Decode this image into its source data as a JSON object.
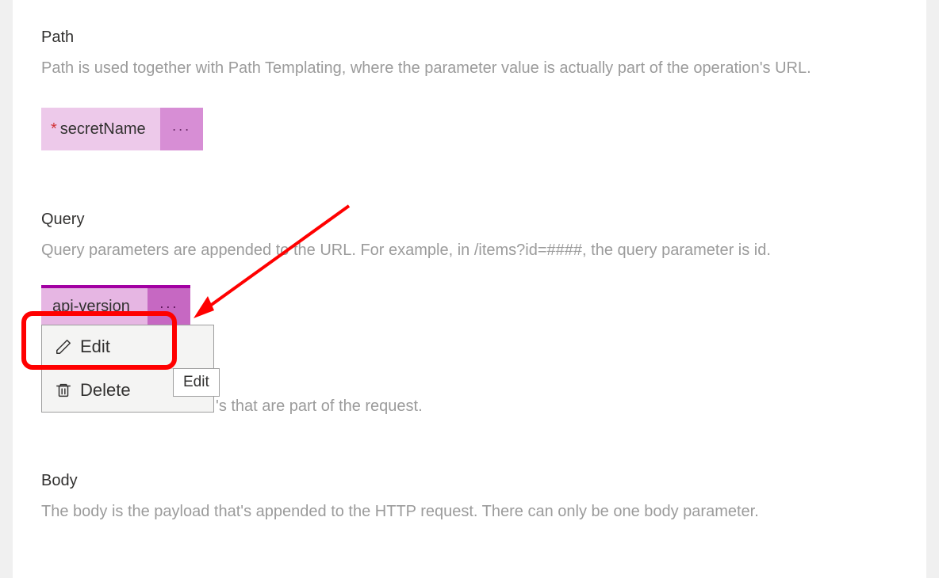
{
  "path": {
    "title": "Path",
    "desc": "Path is used together with Path Templating, where the parameter value is actually part of the operation's URL.",
    "param": {
      "required_marker": "*",
      "name": "secretName",
      "menu_glyph": "···"
    }
  },
  "query": {
    "title": "Query",
    "desc": "Query parameters are appended to the URL. For example, in /items?id=####, the query parameter is id.",
    "param": {
      "name": "api-version",
      "menu_glyph": "···"
    },
    "context_menu": {
      "edit": "Edit",
      "delete": "Delete"
    },
    "tooltip": "Edit",
    "trailing_fragment": "'s that are part of the request."
  },
  "body": {
    "title": "Body",
    "desc": "The body is the payload that's appended to the HTTP request. There can only be one body parameter."
  }
}
